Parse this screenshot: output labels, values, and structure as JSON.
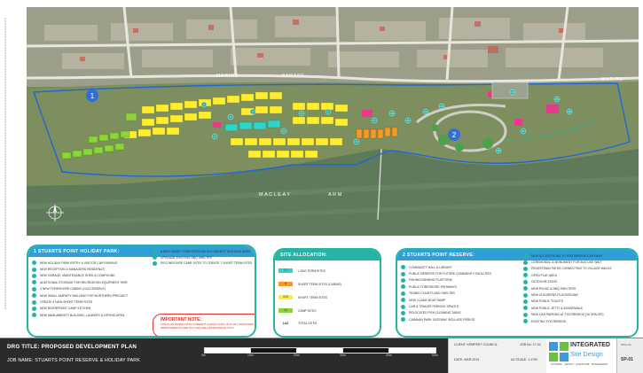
{
  "map": {
    "marker_1": "1",
    "marker_2": "2",
    "road_label_1": "MARINE",
    "road_label_2": "PARADE",
    "road_label_3": "MARINE",
    "water_label_1": "MACLEAY",
    "water_label_2": "ARM",
    "callouts": [
      "1",
      "2",
      "3",
      "4",
      "5",
      "6",
      "7",
      "8",
      "9",
      "10",
      "11",
      "12",
      "13",
      "14",
      "15",
      "16",
      "17",
      "18"
    ]
  },
  "holiday_park": {
    "title": "1  STUARTS POINT HOLIDAY PARK:",
    "items": [
      "NEW HOLIDAY PARK ENTRY & VISITOR CAR PARKING",
      "NEW RECEPTION & MANAGERS RESIDENCE",
      "NEW GARAGE, MAINTENANCE SHED & COMPOUND",
      "ADDITIONAL STORAGE FOR RECREATION EQUIPMENT HIRE",
      "4 NEW FORESHORE CABINS (2 ACCESSIBLE)",
      "NEW SMALL AMENITY BUILDING FOR NORTHERN PRECINCT",
      "CREATE 4 NEW SHORT TERM SITES",
      "NEW RIVERFRONT CAMP KITCHEN",
      "NEW MAIN AMENITY BUILDING, LAUNDRY & DRYING AREA"
    ],
    "extra_items": [
      "8 NEW SHORT TERM SITES ON OLD AMENITY BUILDING AREA",
      "UPGRADE EXISTING BBQ SHELTER",
      "RECONFIGURE CAMP SITES TO CREATE 7 SHORT TERM SITES"
    ]
  },
  "site_allocation": {
    "title": "SITE ALLOCATION:",
    "rows": [
      {
        "count": "17",
        "label": "LONG TERM SITES",
        "color": "#2fd3c8"
      },
      {
        "count": "8",
        "label": "SHORT TERM SITES (CABINS)",
        "color": "#f59a23"
      },
      {
        "count": "103",
        "label": "SHORT TERM SITES",
        "color": "#ffee2e"
      },
      {
        "count": "14",
        "label": "CAMP SITES",
        "color": "#8cd43a"
      }
    ],
    "total_count": "142",
    "total_label": "TOTAL SITES"
  },
  "important_note": {
    "title": "IMPORTANT NOTE:",
    "text": "SITE PLAN BASED UPON CURRENT SURVEY DATA, BUT ANY PROPOSED IMPROVEMENTS ARE NOT AND ARE APPROXIMATE ONLY"
  },
  "reserve": {
    "title": "2  STUARTS POINT RESERVE:",
    "items": [
      "COMMUNITY HALL & LIBRARY",
      "PUBLIC RESERVE FOR FUTURE COMMUNITY FACILITIES",
      "FISHING/VIEWING PLATFORM",
      "PUBLIC FORESHORE PATHWAYS",
      "TENNIS COURTS AND SHELTER",
      "NEW 2-LANE BOAT RAMP",
      "CAR & TRAILER PARKING SPACES",
      "RELOCATED FISH CLEANING TABLE",
      "CARAVAN PARK GATEWAY 'BOLLARD PERIOD'"
    ],
    "extra_items": [
      "NEW ACCESS ROAD TO FOOTBRIDGE CAR PARK",
      "CEREMONIAL & MONUMENT FOR BUS USE WAIT",
      "PEDESTRIAN PATHS CONNECTING TO VILLAGE WALKS",
      "OPEN PLAY AREA",
      "OUTDOOR STAGE",
      "NEW PICNIC & BBQ SHELTERS",
      "NEW CHILDRENS PLAYGROUND",
      "NEW PUBLIC TOILETS",
      "NEW PUBLIC JETTY & BOARDWALK",
      "NEW CAR PARKING AT FOOTBRIDGE (16 SPACES)",
      "EXISTING FOOTBRIDGE"
    ]
  },
  "title_block": {
    "drg_title": "DRG TITLE: PROPOSED DEVELOPMENT PLAN",
    "job_name": "JOB NAME: STUARTS POINT RESERVE & HOLIDAY PARK",
    "scale_labels": [
      "0m",
      "10m",
      "20m",
      "30m",
      "40m",
      "50m"
    ],
    "client": "CLIENT: KEMPSEY COUNCIL",
    "job_no": "JOB No: 17-02",
    "date": "DATE: MAR 2019",
    "a3_scale": "A3 SCALE: 1:1700",
    "logo_name": "INTEGRATED",
    "logo_sub": "Site Design",
    "logo_tag": "PLANNING · DESIGN · LANDSCAPE · MANAGEMENT",
    "dwg_label": "DWG No:",
    "dwg_no": "SP-01"
  }
}
